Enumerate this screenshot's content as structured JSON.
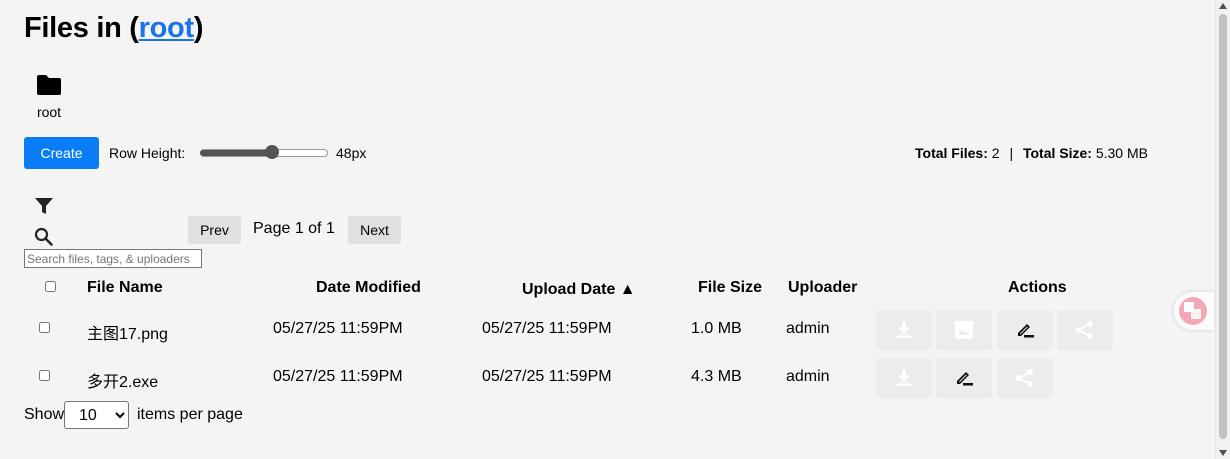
{
  "header": {
    "title_prefix": "Files in (",
    "title_link": "root",
    "title_suffix": ")"
  },
  "folder": {
    "label": "root",
    "icon": "folder-icon"
  },
  "toolbar": {
    "create_label": "Create",
    "row_height_label": "Row Height:",
    "row_height_value": "48px",
    "row_height_fraction": 0.58,
    "total_files_label": "Total Files:",
    "total_files_value": "2",
    "separator": "|",
    "total_size_label": "Total Size:",
    "total_size_value": "5.30 MB"
  },
  "search": {
    "placeholder": "Search files, tags, & uploaders"
  },
  "pagination": {
    "prev": "Prev",
    "page_info": "Page 1 of 1",
    "next": "Next"
  },
  "table": {
    "columns": {
      "file_name": "File Name",
      "date_modified": "Date Modified",
      "upload_date": "Upload Date",
      "upload_sort_arrow": "▲",
      "file_size": "File Size",
      "uploader": "Uploader",
      "actions": "Actions"
    },
    "rows": [
      {
        "name": "主图17.png",
        "modified": "05/27/25 11:59PM",
        "uploaded": "05/27/25 11:59PM",
        "size": "1.0 MB",
        "uploader": "admin",
        "actions": [
          "download",
          "preview",
          "rename",
          "share"
        ]
      },
      {
        "name": "多开2.exe",
        "modified": "05/27/25 11:59PM",
        "uploaded": "05/27/25 11:59PM",
        "size": "4.3 MB",
        "uploader": "admin",
        "actions": [
          "download",
          "rename",
          "share"
        ]
      }
    ]
  },
  "footer": {
    "show_label": "Show",
    "per_page_value": "10",
    "items_label": "items per page"
  },
  "colors": {
    "accent": "#0a7cf5",
    "link": "#1a73e8",
    "background": "#f4f4f4"
  }
}
